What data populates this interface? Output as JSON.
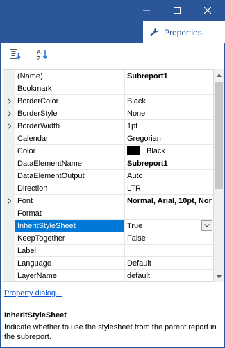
{
  "window": {
    "tab_label": "Properties",
    "controls": {
      "minimize": "minimize",
      "maximize": "maximize",
      "close": "close"
    },
    "accent": "#2b579a"
  },
  "toolbar": {
    "buttons": [
      {
        "icon": "categorized-icon"
      },
      {
        "icon": "alphabetical-sort-icon"
      }
    ]
  },
  "grid": {
    "rows": [
      {
        "name": "(Name)",
        "value": "Subreport1",
        "bold": true,
        "expandable": false
      },
      {
        "name": "Bookmark",
        "value": "",
        "bold": false,
        "expandable": false
      },
      {
        "name": "BorderColor",
        "value": "Black",
        "bold": false,
        "expandable": true
      },
      {
        "name": "BorderStyle",
        "value": "None",
        "bold": false,
        "expandable": true
      },
      {
        "name": "BorderWidth",
        "value": "1pt",
        "bold": false,
        "expandable": true
      },
      {
        "name": "Calendar",
        "value": "Gregorian",
        "bold": false,
        "expandable": false
      },
      {
        "name": "Color",
        "value": "Black",
        "bold": false,
        "expandable": false,
        "swatch": "#000000"
      },
      {
        "name": "DataElementName",
        "value": "Subreport1",
        "bold": true,
        "expandable": false
      },
      {
        "name": "DataElementOutput",
        "value": "Auto",
        "bold": false,
        "expandable": false
      },
      {
        "name": "Direction",
        "value": "LTR",
        "bold": false,
        "expandable": false
      },
      {
        "name": "Font",
        "value": "Normal, Arial, 10pt, Nor",
        "bold": true,
        "expandable": true
      },
      {
        "name": "Format",
        "value": "",
        "bold": false,
        "expandable": false
      },
      {
        "name": "InheritStyleSheet",
        "value": "True",
        "bold": false,
        "expandable": false,
        "selected": true,
        "dropdown": true
      },
      {
        "name": "KeepTogether",
        "value": "False",
        "bold": false,
        "expandable": false
      },
      {
        "name": "Label",
        "value": "",
        "bold": false,
        "expandable": false
      },
      {
        "name": "Language",
        "value": "Default",
        "bold": false,
        "expandable": false
      },
      {
        "name": "LayerName",
        "value": "default",
        "bold": false,
        "expandable": false
      }
    ],
    "selection_color": "#0078d7"
  },
  "link": {
    "label": "Property dialog..."
  },
  "help": {
    "title": "InheritStyleSheet",
    "description": "Indicate whether to use the stylesheet from the parent report in the subreport."
  }
}
